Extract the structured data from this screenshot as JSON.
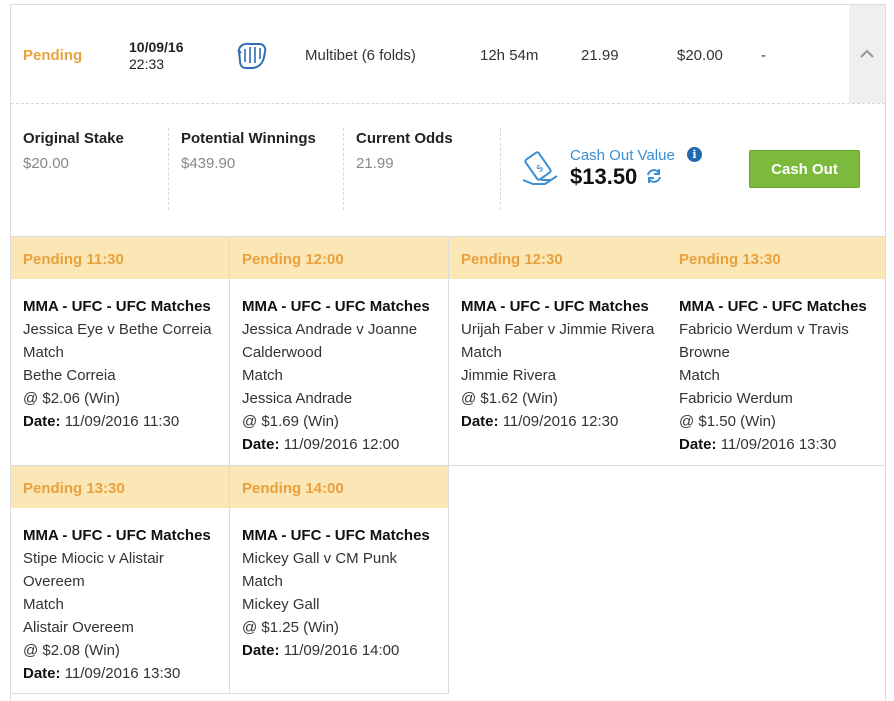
{
  "summary": {
    "status": "Pending",
    "date": "10/09/16",
    "time": "22:33",
    "sport_icon": "boxing-glove-icon",
    "bet_type": "Multibet (6 folds)",
    "time_remaining": "12h 54m",
    "odds": "21.99",
    "stake": "$20.00",
    "returns": "-",
    "toggle_icon": "chevron-up-icon"
  },
  "details": {
    "original_stake_label": "Original Stake",
    "original_stake_value": "$20.00",
    "potential_winnings_label": "Potential Winnings",
    "potential_winnings_value": "$439.90",
    "current_odds_label": "Current Odds",
    "current_odds_value": "21.99",
    "cashout_value_label": "Cash Out Value",
    "cashout_value_amount": "$13.50",
    "info_glyph": "i",
    "cashout_button": "Cash Out"
  },
  "date_label": "Date:",
  "legs": [
    {
      "header": "Pending 11:30",
      "event_type": "MMA - UFC - UFC Matches",
      "lines": [
        "Jessica Eye v Bethe Correia",
        "Match",
        "Bethe Correia",
        "@ $2.06 (Win)"
      ],
      "date": "11/09/2016 11:30"
    },
    {
      "header": "Pending 12:00",
      "event_type": "MMA - UFC - UFC Matches",
      "lines": [
        "Jessica Andrade v Joanne",
        "Calderwood",
        "Match",
        "Jessica Andrade",
        "@ $1.69 (Win)"
      ],
      "date": "11/09/2016 12:00"
    },
    {
      "header": "Pending 12:30",
      "event_type": "MMA - UFC - UFC Matches",
      "lines": [
        "Urijah Faber v Jimmie Rivera",
        "Match",
        "Jimmie Rivera",
        "@ $1.62 (Win)"
      ],
      "date": "11/09/2016 12:30"
    },
    {
      "header": "Pending 13:30",
      "event_type": "MMA - UFC - UFC Matches",
      "lines": [
        "Fabricio Werdum v Travis",
        "Browne",
        "Match",
        "Fabricio Werdum",
        "@ $1.50 (Win)"
      ],
      "date": "11/09/2016 13:30"
    },
    {
      "header": "Pending 13:30",
      "event_type": "MMA - UFC - UFC Matches",
      "lines": [
        "Stipe Miocic v Alistair",
        "Overeem",
        "Match",
        "Alistair Overeem",
        "@ $2.08 (Win)"
      ],
      "date": "11/09/2016 13:30"
    },
    {
      "header": "Pending 14:00",
      "event_type": "MMA - UFC - UFC Matches",
      "lines": [
        "Mickey Gall v CM Punk",
        "Match",
        "Mickey Gall",
        "@ $1.25 (Win)"
      ],
      "date": "11/09/2016 14:00"
    }
  ],
  "colors": {
    "pending": "#e8a13c",
    "pending_bg": "#fbe6b5",
    "cashout_blue": "#3b8ed1",
    "cashout_button": "#7cba3d"
  }
}
